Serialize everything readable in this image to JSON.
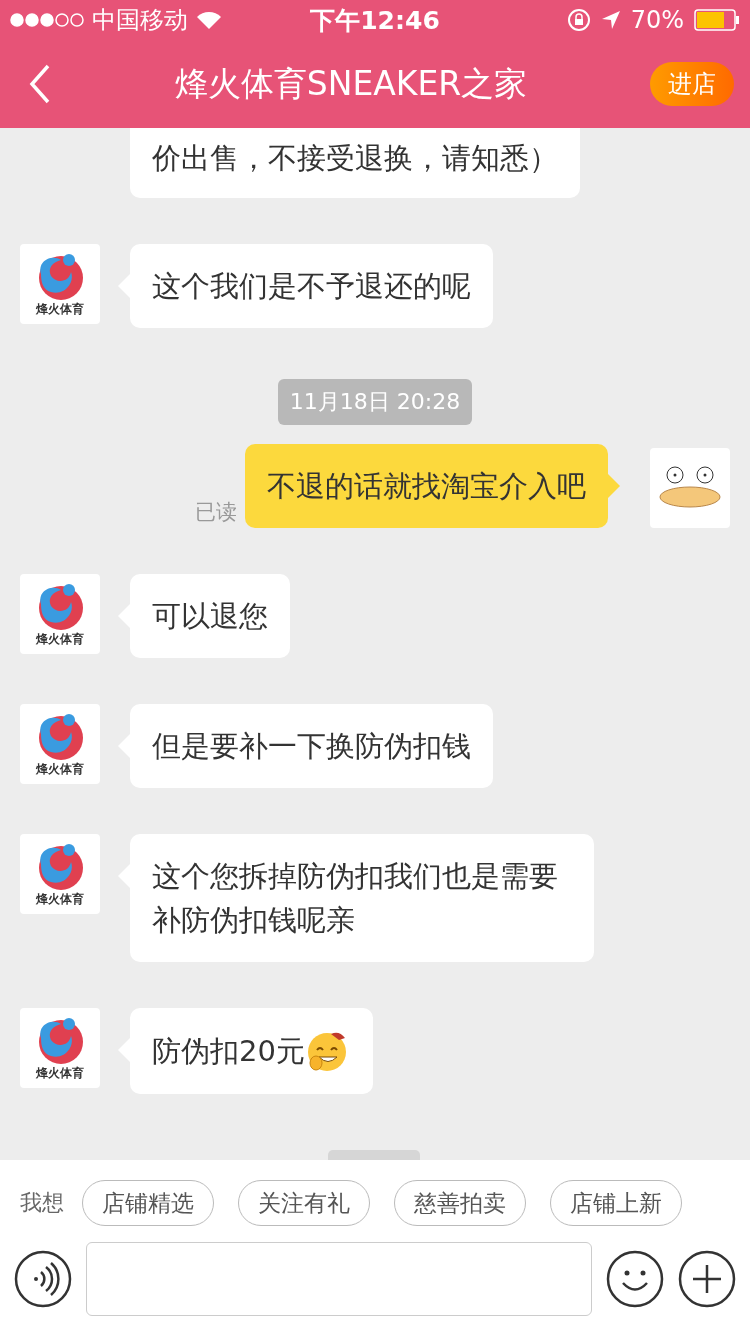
{
  "status_bar": {
    "carrier": "中国移动",
    "time": "下午12:46",
    "battery": "70%"
  },
  "header": {
    "title": "烽火体育SNEAKER之家",
    "action": "进店"
  },
  "messages": [
    {
      "kind": "incoming",
      "partial": true,
      "text": "价出售，不接受退换，请知悉）"
    },
    {
      "kind": "incoming",
      "avatar_label": "烽火体育",
      "text": "这个我们是不予退还的呢"
    },
    {
      "kind": "time",
      "text": "11月18日 20:28"
    },
    {
      "kind": "outgoing",
      "text": "不退的话就找淘宝介入吧",
      "receipt": "已读"
    },
    {
      "kind": "incoming",
      "avatar_label": "烽火体育",
      "text": "可以退您"
    },
    {
      "kind": "incoming",
      "avatar_label": "烽火体育",
      "text": "但是要补一下换防伪扣钱"
    },
    {
      "kind": "incoming",
      "avatar_label": "烽火体育",
      "text": "这个您拆掉防伪扣我们也是需要补防伪扣钱呢亲"
    },
    {
      "kind": "incoming",
      "avatar_label": "烽火体育",
      "text": "防伪扣20元",
      "emoji": true
    }
  ],
  "quick_bar": {
    "label": "我想",
    "chips": [
      "店铺精选",
      "关注有礼",
      "慈善拍卖",
      "店铺上新"
    ]
  }
}
